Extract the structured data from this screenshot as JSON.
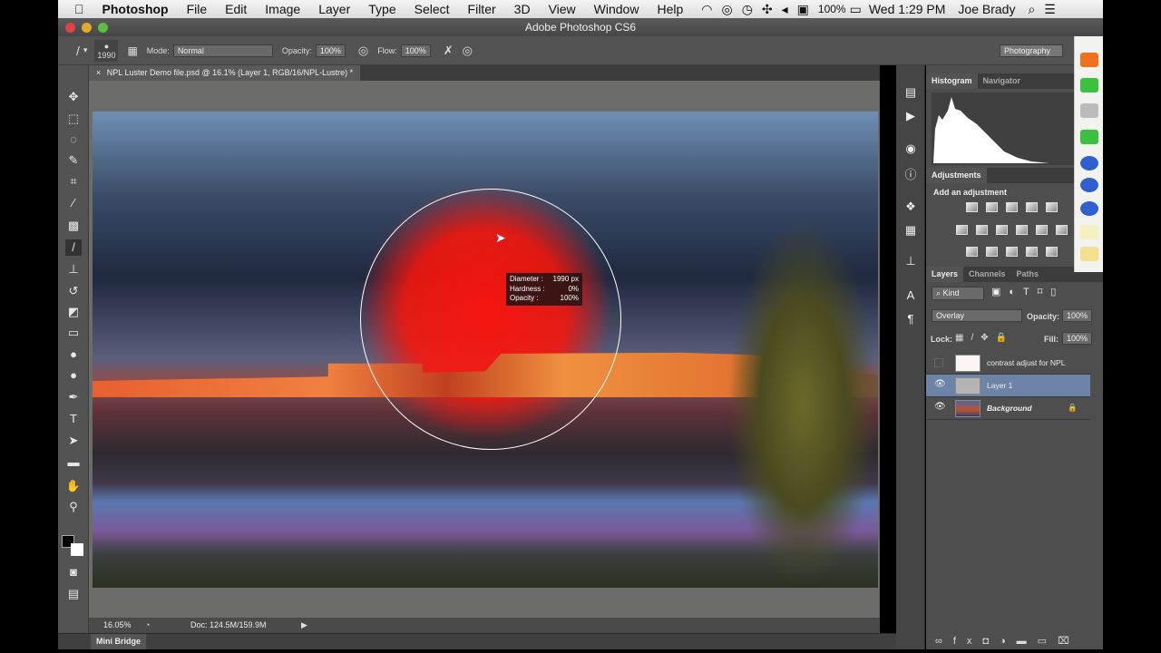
{
  "menubar": {
    "app": "Photoshop",
    "items": [
      "File",
      "Edit",
      "Image",
      "Layer",
      "Type",
      "Select",
      "Filter",
      "3D",
      "View",
      "Window",
      "Help"
    ],
    "battery": "100%",
    "clock": "Wed 1:29 PM",
    "user": "Joe Brady"
  },
  "window": {
    "title": "Adobe Photoshop CS6"
  },
  "options": {
    "brush_size": "1990",
    "mode_label": "Mode:",
    "mode": "Normal",
    "opacity_label": "Opacity:",
    "opacity": "100%",
    "flow_label": "Flow:",
    "flow": "100%",
    "workspace": "Photography"
  },
  "document": {
    "tab": "NPL Luster Demo file.psd @ 16.1% (Layer 1, RGB/16/NPL-Lustre) *"
  },
  "brush_hud": {
    "diameter_label": "Diameter :",
    "diameter": "1990 px",
    "hardness_label": "Hardness :",
    "hardness": "0%",
    "opacity_label": "Opacity :",
    "opacity": "100%"
  },
  "status": {
    "zoom": "16.05%",
    "doc": "Doc: 124.5M/159.9M"
  },
  "mini_bridge": "Mini Bridge",
  "panels": {
    "histogram_tabs": [
      "Histogram",
      "Navigator"
    ],
    "adjustments_tab": "Adjustments",
    "adjustments_hint": "Add an adjustment",
    "layers_tabs": [
      "Layers",
      "Channels",
      "Paths"
    ],
    "filter_kind": "Kind",
    "blend_mode": "Overlay",
    "opacity_label": "Opacity:",
    "opacity": "100%",
    "lock_label": "Lock:",
    "fill_label": "Fill:",
    "fill": "100%",
    "layers": [
      {
        "name": "contrast adjust for NPL",
        "visible": false
      },
      {
        "name": "Layer 1",
        "visible": true,
        "selected": true
      },
      {
        "name": "Background",
        "visible": true,
        "locked": true
      }
    ]
  }
}
